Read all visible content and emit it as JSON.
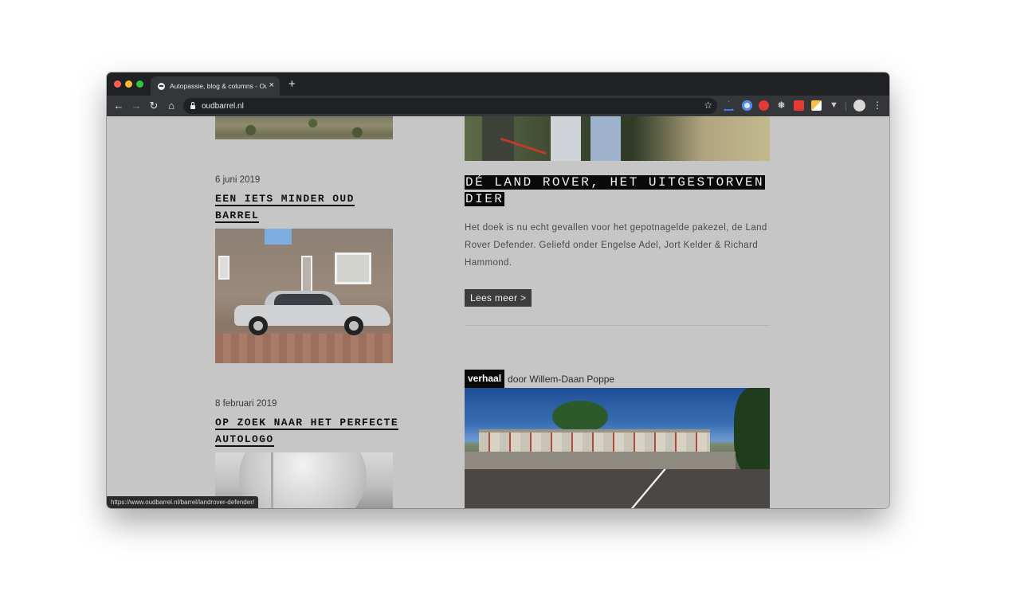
{
  "browser": {
    "tab_title": "Autopassie, blog & columns - Ou",
    "tab_close_label": "×",
    "new_tab_label": "+",
    "url": "oudbarrel.nl",
    "status_url": "https://www.oudbarrel.nl/barrel/landrover-defender/",
    "icons": {
      "back": "arrow-left-icon",
      "forward": "arrow-right-icon",
      "reload": "reload-icon",
      "home": "home-icon",
      "bookmark": "star-icon",
      "menu": "kebab-menu-icon"
    }
  },
  "left_column": {
    "posts": [
      {
        "date": "6 juni 2019",
        "title_line1": "EEN IETS MINDER OUD",
        "title_line2": "BARREL"
      },
      {
        "date": "8 februari 2019",
        "title_line1": "OP ZOEK NAAR HET PERFECTE",
        "title_line2": "AUTOLOGO"
      }
    ]
  },
  "feature": {
    "title": "DÉ LAND ROVER, HET UITGESTORVEN DIER",
    "excerpt": "Het doek is nu echt gevallen voor het gepotnagelde pakezel, de Land Rover Defender. Geliefd onder Engelse Adel, Jort Kelder & Richard Hammond.",
    "read_more": "Lees meer >"
  },
  "next_feature": {
    "category": "verhaal",
    "author": "door Willem-Daan Poppe"
  },
  "colors": {
    "page_background": "#c6c6c6",
    "browser_chrome": "#202124",
    "title_highlight": "#0a0a0a"
  }
}
